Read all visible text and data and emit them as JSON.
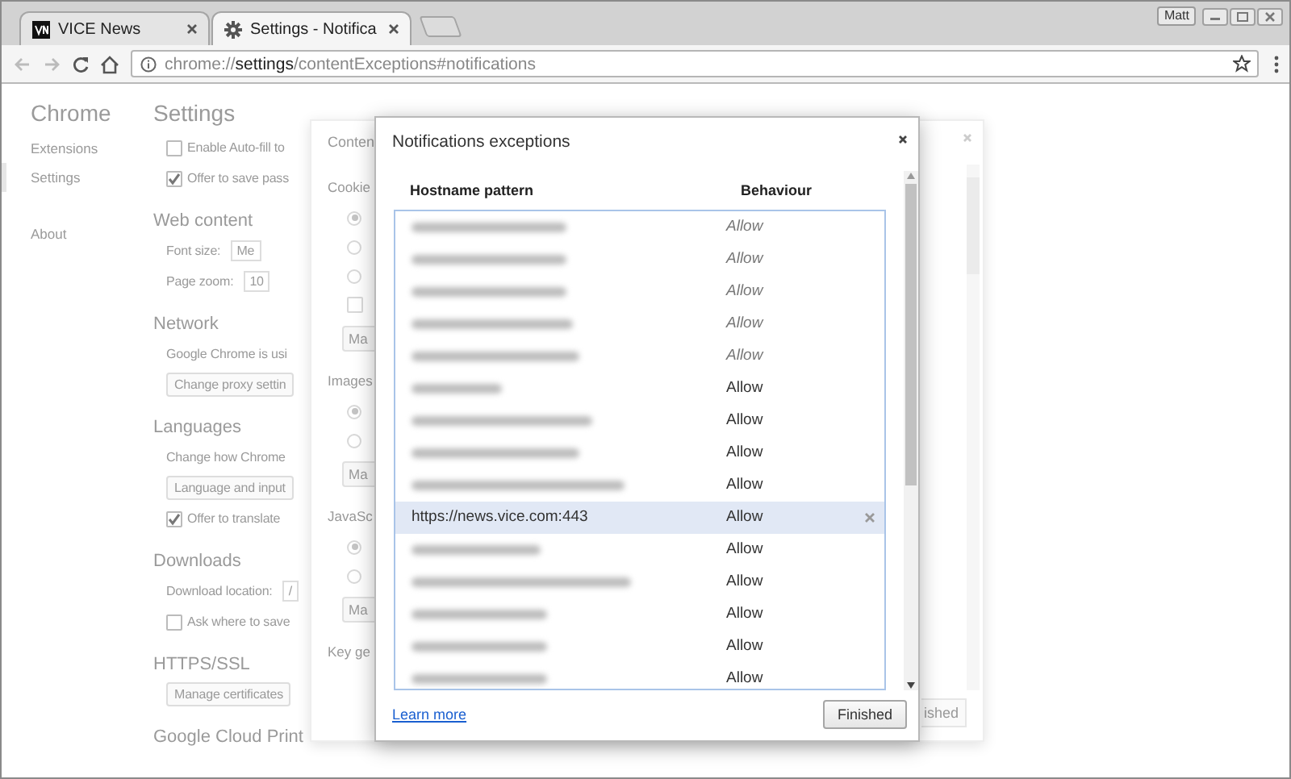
{
  "tabs": [
    {
      "title": "VICE News",
      "selected": false
    },
    {
      "title": "Settings - Notifica",
      "selected": true
    }
  ],
  "profile": "Matt",
  "omnibox": {
    "url": "chrome://**settings**/contentExceptions#notifications"
  },
  "settings_page": {
    "nav_title": "Chrome",
    "nav": [
      {
        "label": "Extensions",
        "selected": false
      },
      {
        "label": "Settings",
        "selected": true
      },
      {
        "label": "About",
        "selected": false
      }
    ],
    "title": "Settings",
    "sections": [
      {
        "items": [
          {
            "kind": "checkbox",
            "label": "Enable Auto-fill to",
            "checked": false
          },
          {
            "kind": "checkbox",
            "label": "Offer to save pass",
            "checked": true
          }
        ]
      },
      {
        "heading": "Web content",
        "items": [
          {
            "kind": "select",
            "label": "Font size:",
            "value": "Me"
          },
          {
            "kind": "select",
            "label": "Page zoom:",
            "value": "10"
          }
        ]
      },
      {
        "heading": "Network",
        "items": [
          {
            "kind": "text",
            "label": "Google Chrome is usi"
          },
          {
            "kind": "button",
            "label": "Change proxy settin"
          }
        ]
      },
      {
        "heading": "Languages",
        "items": [
          {
            "kind": "text",
            "label": "Change how Chrome"
          },
          {
            "kind": "button",
            "label": "Language and input"
          },
          {
            "kind": "checkbox",
            "label": "Offer to translate",
            "checked": true
          }
        ]
      },
      {
        "heading": "Downloads",
        "items": [
          {
            "kind": "select",
            "label": "Download location:",
            "value": "/"
          },
          {
            "kind": "checkbox",
            "label": "Ask where to save",
            "checked": false
          }
        ]
      },
      {
        "heading": "HTTPS/SSL",
        "items": [
          {
            "kind": "button",
            "label": "Manage certificates"
          }
        ]
      },
      {
        "heading": "Google Cloud Print"
      }
    ]
  },
  "content_dialog": {
    "title": "Conten",
    "finish_button": "ished",
    "sections": [
      {
        "heading": "Cookie",
        "options": [
          {
            "kind": "radio",
            "checked": true
          },
          {
            "kind": "radio",
            "checked": false
          },
          {
            "kind": "radio",
            "checked": false
          },
          {
            "kind": "checkbox",
            "checked": false
          }
        ],
        "button": "Ma"
      },
      {
        "heading": "Images",
        "options": [
          {
            "kind": "radio",
            "checked": true
          },
          {
            "kind": "radio",
            "checked": false
          }
        ],
        "button": "Ma"
      },
      {
        "heading": "JavaSc",
        "options": [
          {
            "kind": "radio",
            "checked": true
          },
          {
            "kind": "radio",
            "checked": false
          }
        ],
        "button": "Ma"
      },
      {
        "heading": "Key ge"
      }
    ]
  },
  "exceptions_dialog": {
    "title": "Notifications exceptions",
    "columns": [
      "Hostname pattern",
      "Behaviour"
    ],
    "rows": [
      {
        "blurred": true,
        "behaviour": "Allow",
        "managed": true,
        "selected": false
      },
      {
        "blurred": true,
        "behaviour": "Allow",
        "managed": true,
        "selected": false
      },
      {
        "blurred": true,
        "behaviour": "Allow",
        "managed": true,
        "selected": false
      },
      {
        "blurred": true,
        "behaviour": "Allow",
        "managed": true,
        "selected": false
      },
      {
        "blurred": true,
        "behaviour": "Allow",
        "managed": true,
        "selected": false
      },
      {
        "blurred": true,
        "behaviour": "Allow",
        "managed": false,
        "selected": false
      },
      {
        "blurred": true,
        "behaviour": "Allow",
        "managed": false,
        "selected": false
      },
      {
        "blurred": true,
        "behaviour": "Allow",
        "managed": false,
        "selected": false
      },
      {
        "blurred": true,
        "behaviour": "Allow",
        "managed": false,
        "selected": false
      },
      {
        "blurred": false,
        "hostname": "https://news.vice.com:443",
        "behaviour": "Allow",
        "managed": false,
        "selected": true
      },
      {
        "blurred": true,
        "behaviour": "Allow",
        "managed": false,
        "selected": false
      },
      {
        "blurred": true,
        "behaviour": "Allow",
        "managed": false,
        "selected": false
      },
      {
        "blurred": true,
        "behaviour": "Allow",
        "managed": false,
        "selected": false
      },
      {
        "blurred": true,
        "behaviour": "Allow",
        "managed": false,
        "selected": false
      },
      {
        "blurred": true,
        "behaviour": "Allow",
        "managed": false,
        "selected": false
      }
    ],
    "link": "Learn more",
    "button": "Finished"
  }
}
